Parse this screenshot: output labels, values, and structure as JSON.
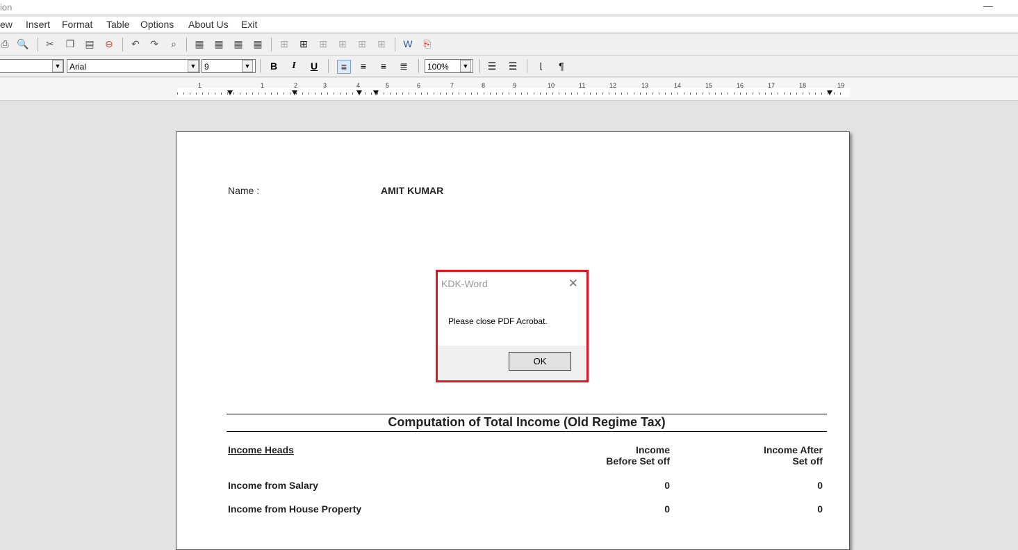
{
  "window": {
    "title": "ion",
    "minimize_glyph": "—"
  },
  "menu": [
    "ew",
    "Insert",
    "Format",
    "Table",
    "Options",
    "About Us",
    "Exit"
  ],
  "toolbar": {
    "font_style_value": "",
    "font_name_value": "Arial",
    "font_size_value": "9",
    "zoom_value": "100%",
    "bold_label": "B",
    "italic_label": "I",
    "underline_label": "U",
    "pilcrow_label": "¶"
  },
  "ruler": {
    "numbers": [
      "1",
      "1",
      "2",
      "3",
      "4",
      "5",
      "6",
      "7",
      "8",
      "9",
      "10",
      "11",
      "12",
      "13",
      "14",
      "15",
      "16",
      "17",
      "18",
      "19"
    ]
  },
  "document": {
    "name_label": "Name :",
    "name_value": "AMIT KUMAR",
    "heading": "Computation of Total Income (Old Regime Tax)",
    "col_head_1": "Income Heads",
    "col_head_2_line1": "Income",
    "col_head_2_line2": "Before Set off",
    "col_head_3_line1": "Income After",
    "col_head_3_line2": "Set off",
    "rows": [
      {
        "label": "Income from Salary",
        "before": "0",
        "after": "0"
      },
      {
        "label": "Income from House Property",
        "before": "0",
        "after": "0"
      }
    ]
  },
  "dialog": {
    "title": "KDK-Word",
    "message": "Please close PDF Acrobat.",
    "ok_label": "OK",
    "highlight_color": "#e3141e"
  }
}
